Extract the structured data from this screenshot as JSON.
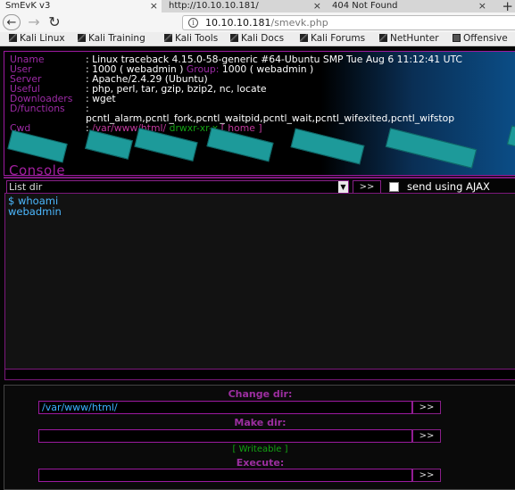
{
  "browser": {
    "tabs": [
      "SmEvK v3",
      "http://10.10.10.181/",
      "404 Not Found"
    ],
    "url_host": "10.10.10.181",
    "url_path": "/smevk.php",
    "bookmarks": [
      "Kali Linux",
      "Kali Training",
      "Kali Tools",
      "Kali Docs",
      "Kali Forums",
      "NetHunter",
      "Offensive"
    ]
  },
  "sysinfo": {
    "uname_label": "Uname",
    "uname": ": Linux traceback 4.15.0-58-generic #64-Ubuntu SMP Tue Aug 6 11:12:41 UTC",
    "user_label": "User",
    "user_val": ": 1000 ( webadmin )",
    "group_label": "Group:",
    "group_val": "1000 ( webadmin )",
    "server_label": "Server",
    "server": ": Apache/2.4.29 (Ubuntu)",
    "useful_label": "Useful",
    "useful": ": php, perl, tar, gzip, bzip2, nc, locate",
    "downloaders_label": "Downloaders",
    "downloaders": ": wget",
    "dfunc_label": "D/functions",
    "dfunc_colon": ":",
    "dfunc": "pcntl_alarm,pcntl_fork,pcntl_waitpid,pcntl_wait,pcntl_wifexited,pcntl_wifstop",
    "cwd_label": "Cwd",
    "cwd_colon": ":",
    "cwd_path": "/var/www/html/",
    "cwd_perms": "drwxr-xr-x",
    "cwd_home": "[ home ]"
  },
  "console": {
    "title": "Console",
    "select_value": "List dir",
    "go_label": ">>",
    "ajax_label": "send using AJAX",
    "output_lines": [
      "$ whoami",
      "webadmin"
    ]
  },
  "panel": {
    "change_dir_label": "Change dir:",
    "change_dir_value": "/var/www/html/",
    "make_dir_label": "Make dir:",
    "make_dir_value": "",
    "writeable_label": "[ Writeable ]",
    "execute_label": "Execute:",
    "execute_value": "",
    "go_label": ">>"
  }
}
